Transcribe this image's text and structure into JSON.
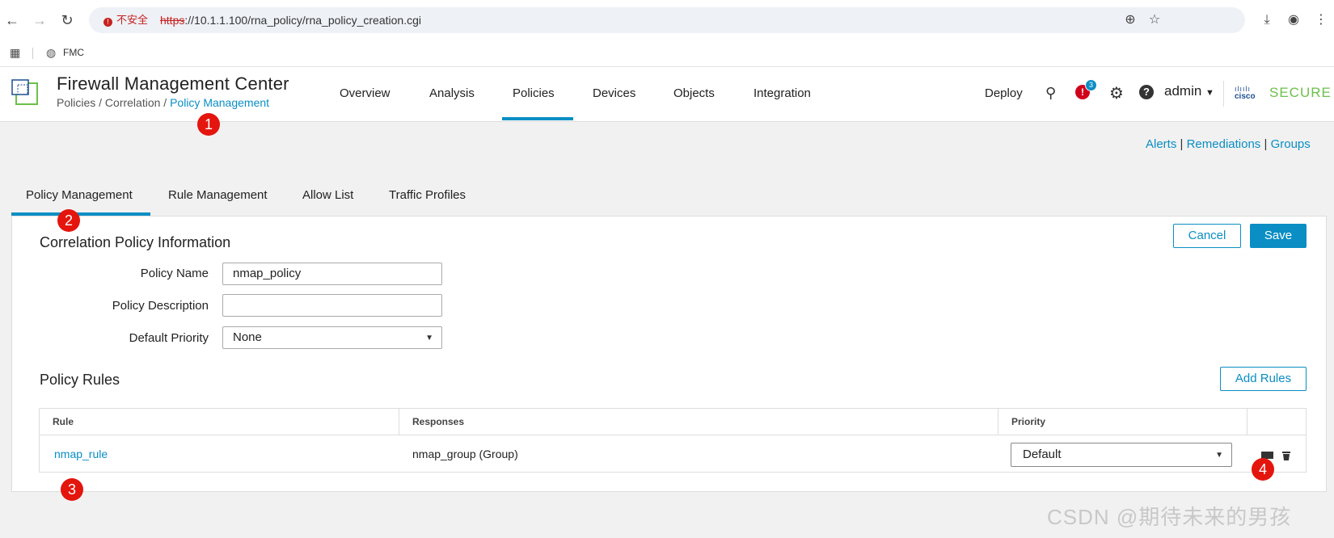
{
  "browser": {
    "insecure_label": "不安全",
    "url_scheme": "https",
    "url_rest": "://10.1.1.100/rna_policy/rna_policy_creation.cgi",
    "bookmark": "FMC"
  },
  "header": {
    "app_title": "Firewall Management Center",
    "breadcrumb": {
      "part1": "Policies",
      "sep": " / ",
      "part2": "Correlation",
      "active": "Policy Management"
    },
    "nav": [
      "Overview",
      "Analysis",
      "Policies",
      "Devices",
      "Objects",
      "Integration"
    ],
    "active_nav": "Policies",
    "deploy": "Deploy",
    "alert_count": "3",
    "user": "admin",
    "brand_top": "cisco",
    "brand": "SECURE"
  },
  "top_links": {
    "alerts": "Alerts",
    "remediations": "Remediations",
    "groups": "Groups",
    "sep": "|"
  },
  "sub_tabs": [
    "Policy Management",
    "Rule Management",
    "Allow List",
    "Traffic Profiles"
  ],
  "active_sub_tab": "Policy Management",
  "form": {
    "section_title": "Correlation Policy Information",
    "cancel": "Cancel",
    "save": "Save",
    "name_label": "Policy Name",
    "name_value": "nmap_policy",
    "desc_label": "Policy Description",
    "desc_value": "",
    "priority_label": "Default Priority",
    "priority_value": "None"
  },
  "rules": {
    "section_title": "Policy Rules",
    "add_button": "Add Rules",
    "columns": [
      "Rule",
      "Responses",
      "Priority"
    ],
    "rows": [
      {
        "rule": "nmap_rule",
        "responses": "nmap_group (Group)",
        "priority": "Default"
      }
    ]
  },
  "markers": [
    "1",
    "2",
    "3",
    "4"
  ],
  "watermark": "CSDN @期待未来的男孩",
  "colors": {
    "accent": "#0a8ec4",
    "marker": "#e4150d",
    "alert": "#d0021b",
    "brand_green": "#6cc04a"
  }
}
